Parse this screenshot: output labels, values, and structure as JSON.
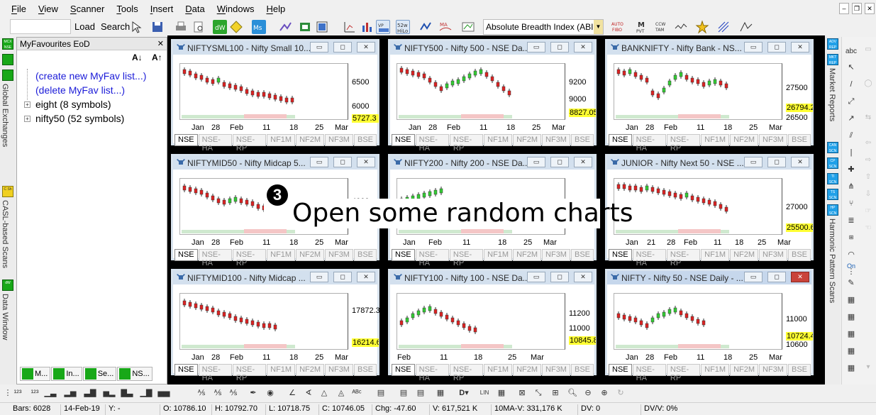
{
  "menu": [
    "File",
    "View",
    "Scanner",
    "Tools",
    "Insert",
    "Data",
    "Windows",
    "Help"
  ],
  "toolbar": {
    "load_label": "Load",
    "search_label": "Search",
    "breadth_selected": "Absolute Breadth Index (ABI",
    "tool_texts": {
      "week52": "52w HiLo",
      "auto_fibo": "AUTO FIBO",
      "mpvt": "M PVT",
      "ccw": "CCW TAM"
    }
  },
  "left_tabs": [
    {
      "icon": "MCX NSE",
      "label": "Global Exchanges"
    },
    {
      "icon": "C Sh",
      "label": "CASL-based Scans"
    },
    {
      "icon": "dW",
      "label": "Data Window"
    }
  ],
  "favourites": {
    "title": "MyFavourites EoD",
    "sort_asc": "A↓",
    "sort_desc": "A↑",
    "items": [
      {
        "type": "link",
        "label": "(create new MyFav list...)"
      },
      {
        "type": "link",
        "label": "(delete MyFav list...)"
      },
      {
        "type": "node",
        "label": "eight (8 symbols)"
      },
      {
        "type": "node",
        "label": "nifty50 (52 symbols)"
      }
    ],
    "bottom_tabs": [
      "M...",
      "In...",
      "Se...",
      "NS..."
    ]
  },
  "charts": [
    {
      "title": "NIFTYSML100 - Nifty Small 10...",
      "y_labels": [
        "6500",
        "6000"
      ],
      "last": "5727.3",
      "x_labels": [
        "Jan",
        "28",
        "Feb",
        "11",
        "18",
        "25",
        "Mar"
      ]
    },
    {
      "title": "NIFTY500 - Nifty 500 - NSE Da...",
      "y_labels": [
        "9200",
        "9000"
      ],
      "last": "8827.05",
      "x_labels": [
        "Jan",
        "28",
        "Feb",
        "11",
        "18",
        "25",
        "Mar"
      ]
    },
    {
      "title": "BANKNIFTY - Nifty Bank - NS...",
      "y_labels": [
        "27500",
        "26500"
      ],
      "last": "26794.2",
      "x_labels": [
        "Jan",
        "28",
        "Feb",
        "11",
        "18",
        "25",
        "Mar"
      ]
    },
    {
      "title": "NIFTYMID50 - Nifty Midcap 5...",
      "y_labels": [
        "4000"
      ],
      "last": "",
      "x_labels": [
        "Jan",
        "28",
        "Feb",
        "11",
        "18",
        "25",
        "Mar"
      ]
    },
    {
      "title": "NIFTY200 - Nifty 200 - NSE Da...",
      "y_labels": [],
      "last": "",
      "x_labels": [
        "Jan",
        "Feb",
        "11",
        "18",
        "25",
        "Mar"
      ]
    },
    {
      "title": "JUNIOR - Nifty Next 50 - NSE ...",
      "y_labels": [
        "27000"
      ],
      "last": "25500.6",
      "x_labels": [
        "Jan",
        "21",
        "28",
        "Feb",
        "11",
        "18",
        "25",
        "Mar"
      ]
    },
    {
      "title": "NIFTYMID100 - Nifty Midcap ...",
      "y_labels": [
        "17872.3"
      ],
      "last": "16214.6",
      "x_labels": [
        "Jan",
        "28",
        "Feb",
        "11",
        "18",
        "25",
        "Mar"
      ]
    },
    {
      "title": "NIFTY100 - Nifty 100 - NSE Da...",
      "y_labels": [
        "11200",
        "11000"
      ],
      "last": "10845.8",
      "x_labels": [
        "Feb",
        "11",
        "18",
        "25",
        "Mar"
      ]
    },
    {
      "title": "NIFTY - Nifty 50 - NSE Daily - ...",
      "y_labels": [
        "11000",
        "10600"
      ],
      "last": "10724.4",
      "x_labels": [
        "Jan",
        "28",
        "Feb",
        "11",
        "18",
        "25",
        "Mar"
      ]
    }
  ],
  "exchange_tabs": [
    "NSE",
    "NSE-HA",
    "NSE-RP",
    "NF1M",
    "NF2M",
    "NF3M",
    "BSE"
  ],
  "annotation": {
    "number": "3",
    "text": "Open some random charts"
  },
  "right_tabs": [
    {
      "icon": "ADV REP",
      "label": "Market Reports"
    },
    {
      "icon": "CAN SCN",
      "label": "Harmonic Pattern Scans"
    }
  ],
  "right_tab_icons": [
    "ADV REP",
    "MKT REP",
    "CAN SCN",
    "CP SCN",
    "TI SCN",
    "TS SCN",
    "HP SCN"
  ],
  "draw_tools": [
    "abc",
    "On"
  ],
  "status": {
    "bars": "Bars: 6028",
    "date": "14-Feb-19",
    "y": "Y: -",
    "open": "O: 10786.10",
    "high": "H: 10792.70",
    "low": "L: 10718.75",
    "close": "C: 10746.05",
    "chg": "Chg: -47.60",
    "vol": "V: 617,521 K",
    "ma": "10MA-V: 331,176 K",
    "dv": "DV: 0",
    "dvv": "DV/V: 0%"
  }
}
